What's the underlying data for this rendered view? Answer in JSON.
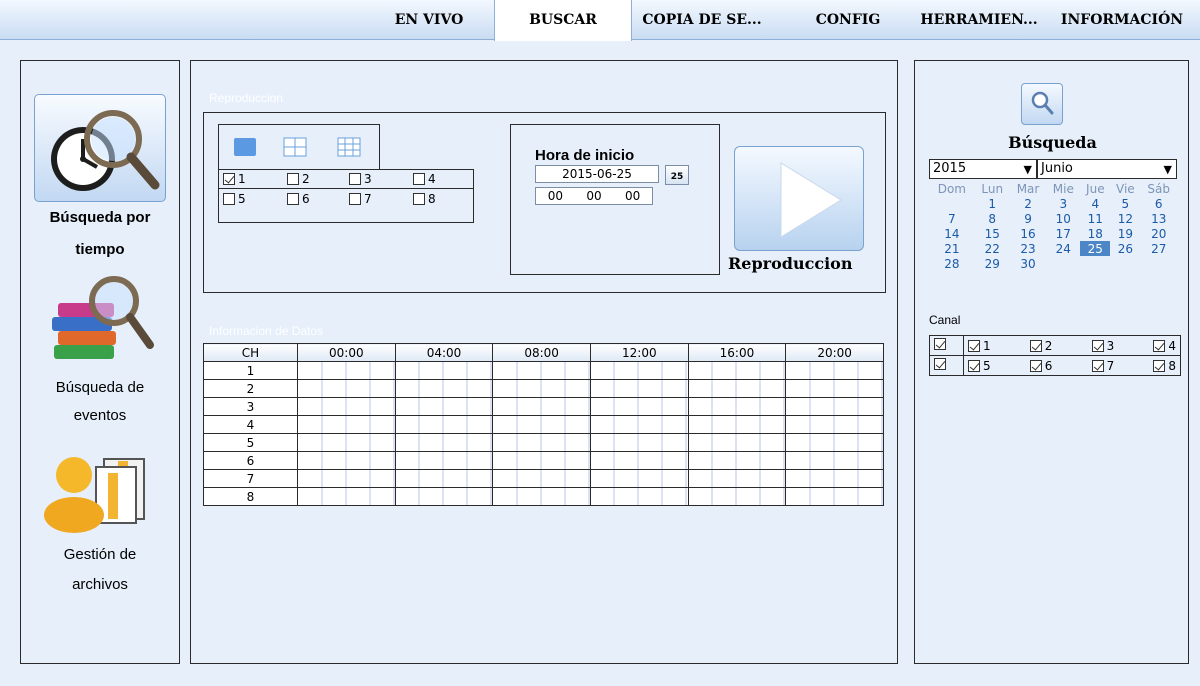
{
  "nav": {
    "tabs": [
      {
        "label": "EN VIVO"
      },
      {
        "label": "BUSCAR"
      },
      {
        "label": "COPIA DE SE..."
      },
      {
        "label": "CONFIG"
      },
      {
        "label": "HERRAMIEN..."
      },
      {
        "label": "INFORMACIÓN"
      }
    ],
    "active": "BUSCAR"
  },
  "sidebar": {
    "time_search": {
      "line1": "Búsqueda por",
      "line2": "tiempo",
      "icon": "clock-search-icon"
    },
    "event_search": {
      "line1": "Búsqueda de",
      "line2": "eventos",
      "icon": "books-search-icon"
    },
    "file_mgmt": {
      "line1": "Gestión de",
      "line2": "archivos",
      "icon": "user-files-icon"
    }
  },
  "playback": {
    "section_title": "Reproduccion",
    "channels": [
      {
        "label": "1",
        "checked": true
      },
      {
        "label": "2",
        "checked": false
      },
      {
        "label": "3",
        "checked": false
      },
      {
        "label": "4",
        "checked": false
      },
      {
        "label": "5",
        "checked": false
      },
      {
        "label": "6",
        "checked": false
      },
      {
        "label": "7",
        "checked": false
      },
      {
        "label": "8",
        "checked": false
      }
    ],
    "start_title": "Hora de inicio",
    "date": "2015-06-25",
    "calendar_button": "25",
    "time": {
      "h": "00",
      "m": "00",
      "s": "00"
    },
    "play_label": "Reproduccion"
  },
  "data_info": {
    "section_title": "Informacion de Datos",
    "columns": [
      "CH",
      "00:00",
      "04:00",
      "08:00",
      "12:00",
      "16:00",
      "20:00"
    ],
    "rows": [
      "1",
      "2",
      "3",
      "4",
      "5",
      "6",
      "7",
      "8"
    ]
  },
  "search_panel": {
    "title": "Búsqueda",
    "year": "2015",
    "month": "Junio",
    "weekdays": [
      "Dom",
      "Lun",
      "Mar",
      "Mie",
      "Jue",
      "Vie",
      "Sáb"
    ],
    "weeks": [
      [
        "",
        "1",
        "2",
        "3",
        "4",
        "5",
        "6"
      ],
      [
        "7",
        "8",
        "9",
        "10",
        "11",
        "12",
        "13"
      ],
      [
        "14",
        "15",
        "16",
        "17",
        "18",
        "19",
        "20"
      ],
      [
        "21",
        "22",
        "23",
        "24",
        "25",
        "26",
        "27"
      ],
      [
        "28",
        "29",
        "30",
        "",
        "",
        "",
        ""
      ]
    ],
    "selected_day": "25",
    "canal_label": "Canal",
    "canal_rows": [
      {
        "all_checked": true,
        "channels": [
          {
            "label": "1",
            "checked": true
          },
          {
            "label": "2",
            "checked": true
          },
          {
            "label": "3",
            "checked": true
          },
          {
            "label": "4",
            "checked": true
          }
        ]
      },
      {
        "all_checked": true,
        "channels": [
          {
            "label": "5",
            "checked": true
          },
          {
            "label": "6",
            "checked": true
          },
          {
            "label": "7",
            "checked": true
          },
          {
            "label": "8",
            "checked": true
          }
        ]
      }
    ]
  },
  "colors": {
    "accent": "#4f93dc",
    "selected_day": "#4c86c6",
    "background": "#e6effa"
  }
}
